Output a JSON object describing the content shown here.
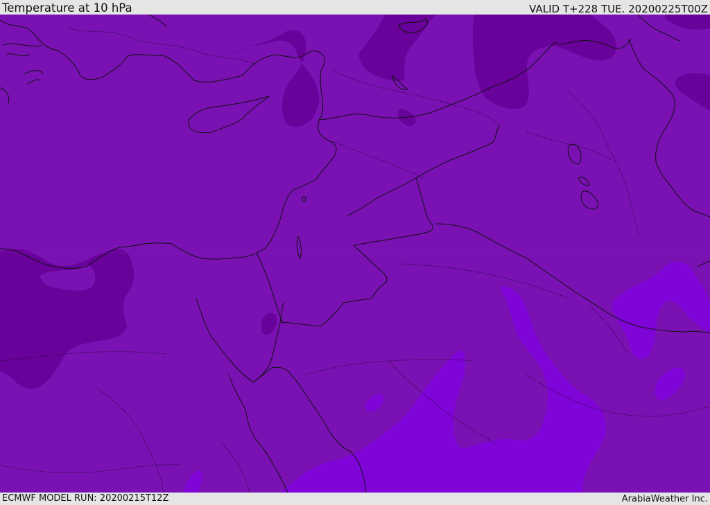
{
  "header": {
    "title": "Temperature at 10 hPa",
    "valid": "VALID T+228 TUE. 20200225T00Z"
  },
  "footer": {
    "model_run": "ECMWF MODEL RUN: 20200215T12Z",
    "credit": "ArabiaWeather Inc."
  },
  "colors": {
    "base_field": "#7a11b3",
    "cold_field": "#69029b",
    "warm_field": "#7f04d8",
    "coastline": "#111111",
    "border": "#111111",
    "background": "#e5e5e5"
  },
  "map": {
    "field": "temperature",
    "level": "10 hPa",
    "region": "Middle East"
  }
}
